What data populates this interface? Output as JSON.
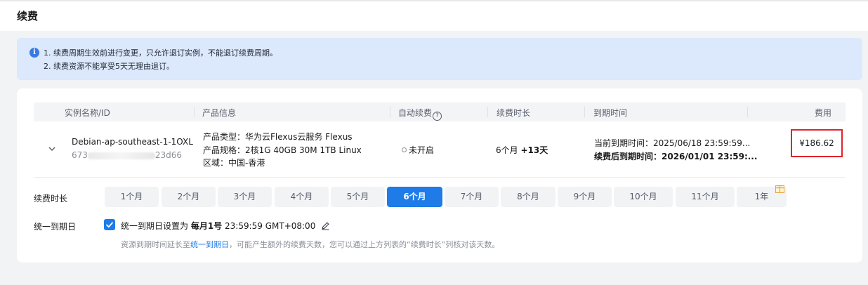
{
  "header": {
    "title": "续费"
  },
  "notice": {
    "icon": "info-icon",
    "lines": [
      "1. 续费周期生效前进行变更，只允许退订实例，不能退订续费周期。",
      "2. 续费资源不能享受5天无理由退订。"
    ]
  },
  "table": {
    "columns": {
      "name": "实例名称/ID",
      "product": "产品信息",
      "auto_renew": "自动续费",
      "duration": "续费时长",
      "expiry": "到期时间",
      "fee": "费用"
    },
    "row": {
      "name": "Debian-ap-southeast-1-1OXL",
      "id_prefix": "673",
      "id_suffix": "23d66",
      "product_type": "产品类型：华为云Flexus云服务 Flexus",
      "product_spec": "产品规格：2核1G 40GB 30M 1TB Linux",
      "region": "区域：中国-香港",
      "auto_renew": "未开启",
      "duration_main": "6个月 ",
      "duration_extra": "+13天",
      "current_expiry": "当前到期时间：2025/06/18 23:59:59...",
      "renewed_expiry": "续费后到期时间：2026/01/01 23:59:...",
      "fee": "¥186.62"
    }
  },
  "duration_selector": {
    "label": "续费时长",
    "options": [
      "1个月",
      "2个月",
      "3个月",
      "4个月",
      "5个月",
      "6个月",
      "7个月",
      "8个月",
      "9个月",
      "10个月",
      "11个月",
      "1年"
    ],
    "selected": "6个月"
  },
  "unify": {
    "label": "统一到期日",
    "text_prefix": "统一到期日设置为 ",
    "text_bold": "每月1号",
    "text_suffix": " 23:59:59 GMT+08:00",
    "hint_prefix": "资源到期时间延长至",
    "hint_link": "统一到期日",
    "hint_suffix": "，可能产生额外的续费天数，您可以通过上方列表的“续费时长”列核对该天数。",
    "checked": true
  },
  "colors": {
    "accent": "#1e7be8",
    "highlight_border": "#e0242b",
    "notice_bg": "#dce8fb"
  }
}
